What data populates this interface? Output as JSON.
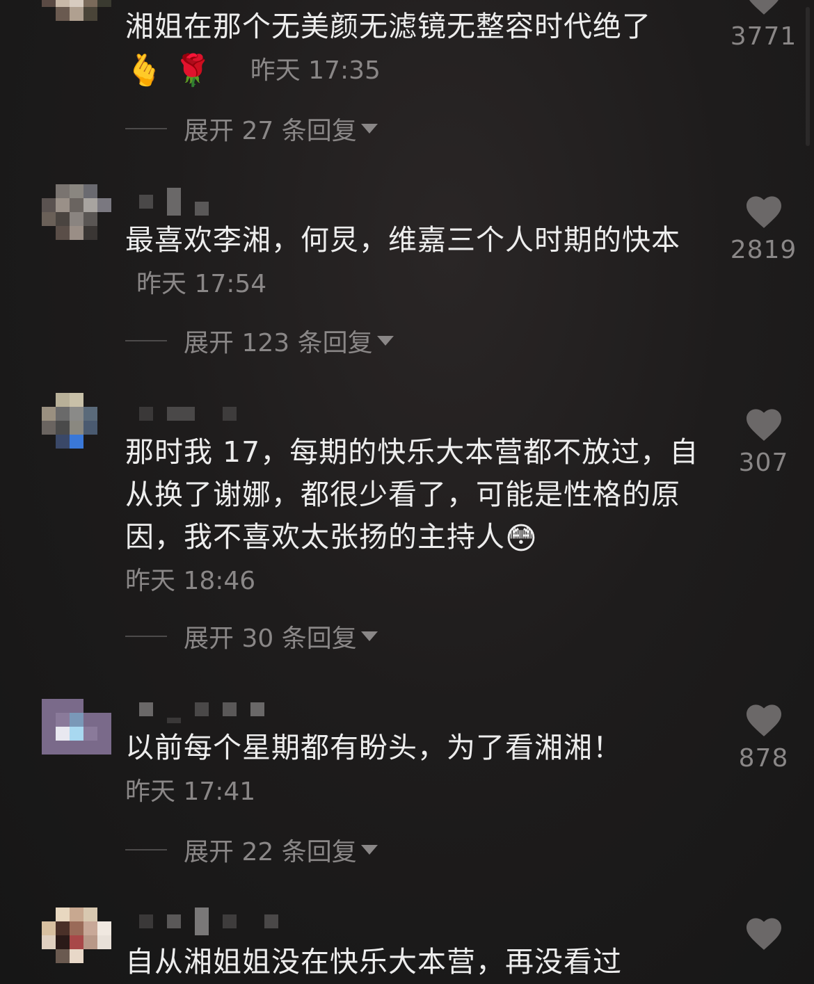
{
  "comments": [
    {
      "text": "湘姐在那个无美颜无滤镜无整容时代绝了",
      "emojis": [
        "🫰",
        "🌹"
      ],
      "time": "昨天 17:35",
      "expand_label": "展开 27 条回复",
      "likes": "3771",
      "liked": false
    },
    {
      "text": "最喜欢李湘，何炅，维嘉三个人时期的快本",
      "time": "昨天 17:54",
      "expand_label": "展开 123 条回复",
      "likes": "2819",
      "liked": false
    },
    {
      "text": "那时我 17，每期的快乐大本营都不放过，自从换了谢娜，都很少看了，可能是性格的原因，我不喜欢太张扬的主持人",
      "emoji_end": "😳",
      "time": "昨天 18:46",
      "expand_label": "展开 30 条回复",
      "likes": "307",
      "liked": false
    },
    {
      "text": "以前每个星期都有盼头，为了看湘湘！",
      "time": "昨天 17:41",
      "expand_label": "展开 22 条回复",
      "likes": "878",
      "liked": false
    },
    {
      "text": "自从湘姐姐没在快乐大本营，再没看过",
      "likes": "",
      "liked": false
    }
  ],
  "colors": {
    "background": "#1c1b1b",
    "text": "#ededed",
    "secondary": "#8a8787",
    "heart": "#6b6868"
  },
  "icons": {
    "like": "heart-icon",
    "expand": "caret-down-icon"
  }
}
